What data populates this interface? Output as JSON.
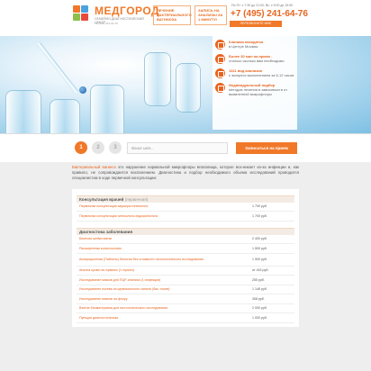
{
  "header": {
    "logo_title": "МЕДГОРОД",
    "logo_sub": "СЕМЕЙНО-ДИАГНОСТИЧЕСКИЙ ЦЕНТР",
    "logo_phone": "+7 (495) 241-64-76",
    "box1": "ЛЕЧЕНИЕ БАКТЕРИАЛЬНОГО ВАГИНОЗА",
    "box2": "ЗАПИСЬ НА АНАЛИЗЫ ЗА 1 МИНУТУ!",
    "hours": "Пн-Пт: с 7:30 до 21:00, Вс: с 9:00 до 19:00",
    "phone": "+7 (495) 241-64-76",
    "callback": "ПЕРЕЗВОНИТЕ МНЕ"
  },
  "features": [
    {
      "bold": "Клиники находятся",
      "text": "в Центре Москвы"
    },
    {
      "bold": "Более 30 мин на прием -",
      "text": "столько сколько вам необходимо"
    },
    {
      "bold": "1311 вид анализов",
      "text": "с экспресс выполнением за 6-12 часов"
    },
    {
      "bold": "Индивидуальный подбор",
      "text": "методов лечения в зависимости от выявленной микрофлоры"
    }
  ],
  "booking": {
    "steps": [
      "1",
      "2",
      "3"
    ],
    "name_placeholder": "Ваше имя...",
    "submit": "Записаться на прием"
  },
  "intro": {
    "highlight": "Бактериальный вагиноз",
    "text": " это нарушение нормальной микрофлоры влагалища, которое воз-никает из-за инфекции и, как правило, не сопровождается воспалением. Диагностика и подбор необходимого объема исследований проводится специалистом в ходе первичной консультации:"
  },
  "sections": [
    {
      "title": "Консультация врачей",
      "note": "(первичная)",
      "rows": [
        {
          "name": "Первичная консультация акушера-гинеколога",
          "price": "1 700 руб."
        },
        {
          "name": "Первичная консультация гинеколога-эндокринолога",
          "price": "1 700 руб."
        }
      ]
    },
    {
      "title": "Диагностика заболевания",
      "note": "",
      "rows": [
        {
          "name": "Биопсия шейки матки",
          "price": "2 400 руб."
        },
        {
          "name": "Расширенная кольпоскопия",
          "price": "1 500 руб."
        },
        {
          "name": "Аспирационная (Пайпель) биопсия без стоимости гистологического исследования",
          "price": "1 900 руб."
        },
        {
          "name": "Анализ крови на гормоны (1 гормон)",
          "price": "от 415 руб."
        },
        {
          "name": "Исследование мазков для ПЦР-анализа (1 инфекция)",
          "price": "255 руб."
        },
        {
          "name": "Исследование посева из цервикального канала (бак. посев)",
          "price": "1 148 руб."
        },
        {
          "name": "Исследование мазков на флору",
          "price": "308 руб."
        },
        {
          "name": "Взятие биоматериала для гистологического исследования",
          "price": "2 000 руб."
        },
        {
          "name": "Пункция диагностическая",
          "price": "1 000 руб."
        }
      ]
    }
  ],
  "colors": {
    "accent": "#f07828",
    "brand_text": "#e8651f"
  }
}
